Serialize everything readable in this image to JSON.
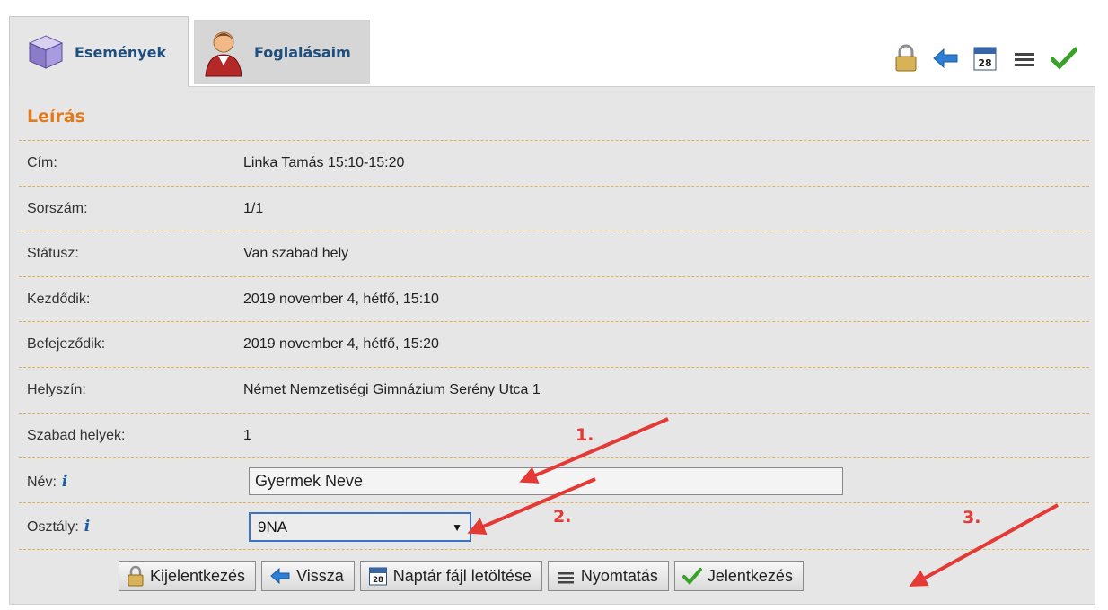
{
  "tabs": [
    {
      "label": "Események",
      "icon": "cube-icon",
      "active": true
    },
    {
      "label": "Foglalásaim",
      "icon": "user-icon",
      "active": false
    }
  ],
  "toolbar_icons": [
    "lock-icon",
    "back-arrow-icon",
    "calendar-icon",
    "print-icon",
    "check-icon"
  ],
  "section_title": "Leírás",
  "fields": [
    {
      "label": "Cím:",
      "value": "Linka Tamás 15:10-15:20"
    },
    {
      "label": "Sorszám:",
      "value": "1/1"
    },
    {
      "label": "Státusz:",
      "value": "Van szabad hely"
    },
    {
      "label": "Kezdődik:",
      "value": "2019 november 4, hétfő, 15:10"
    },
    {
      "label": "Befejeződik:",
      "value": "2019 november 4, hétfő, 15:20"
    },
    {
      "label": "Helyszín:",
      "value": "Német Nemzetiségi Gimnázium Serény Utca 1"
    },
    {
      "label": "Szabad helyek:",
      "value": "1"
    }
  ],
  "name_field": {
    "label": "Név:",
    "value": "Gyermek Neve"
  },
  "class_field": {
    "label": "Osztály:",
    "value": "9NA"
  },
  "info_glyph": "i",
  "buttons": {
    "logout": "Kijelentkezés",
    "back": "Vissza",
    "calendar": "Naptár fájl letöltése",
    "print": "Nyomtatás",
    "register": "Jelentkezés"
  },
  "calendar_day": "28",
  "annotations": [
    "1.",
    "2.",
    "3."
  ],
  "colors": {
    "accent_orange": "#e07a1e",
    "link_blue": "#1d4e7e",
    "annotation_red": "#e53935",
    "check_green": "#3aa12a"
  }
}
